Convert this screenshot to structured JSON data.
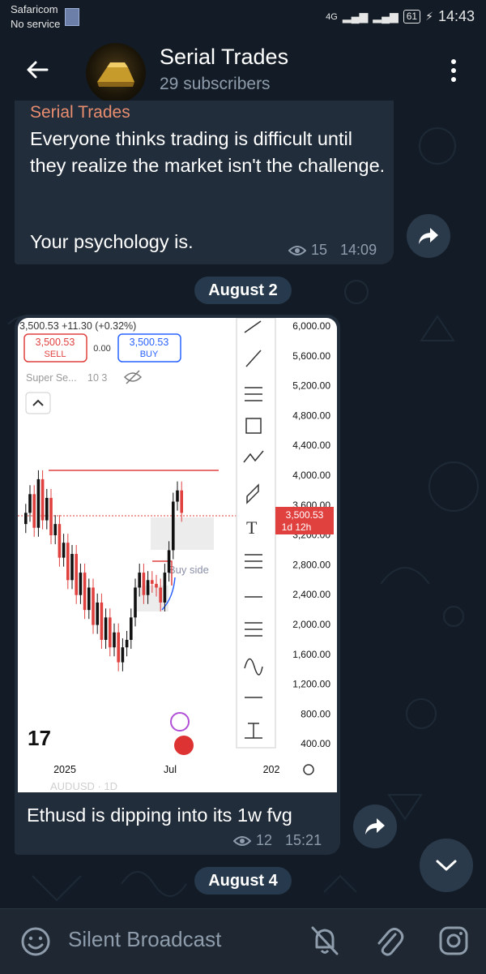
{
  "status_bar": {
    "carrier": "Safaricom",
    "service": "No service",
    "network": "4G",
    "battery": "61",
    "time": "14:43"
  },
  "header": {
    "channel_name": "Serial Trades",
    "subscribers": "29 subscribers",
    "icons": [
      "back-arrow-icon",
      "more-vertical-icon"
    ]
  },
  "messages": [
    {
      "sender": "Serial Trades",
      "text_line1": "Everyone thinks trading is difficult until they realize the market isn't the challenge.",
      "text_line2": "Your psychology is.",
      "views": "15",
      "time": "14:09"
    },
    {
      "date_separator": "August 2",
      "caption": "Ethusd is dipping into its 1w fvg",
      "views": "12",
      "time": "15:21"
    }
  ],
  "date_separator_bottom": "August 4",
  "chart_image": {
    "top_quote": "3,500.53 +11.30 (+0.32%)",
    "sell_price": "3,500.53",
    "sell_label": "SELL",
    "spread": "0.00",
    "buy_price": "3,500.53",
    "buy_label": "BUY",
    "indicator": "Super Se...",
    "indicator_params": "10 3",
    "current_price": "3,500.53",
    "countdown": "1d 12h",
    "zone_label": "Buy side",
    "bottom_watermark": "AUDUSD · 1D",
    "x_ticks": [
      "2025",
      "Jul",
      "202"
    ],
    "y_ticks": [
      "6,000.00",
      "5,600.00",
      "5,200.00",
      "4,800.00",
      "4,400.00",
      "4,000.00",
      "3,600.00",
      "3,200.00",
      "2,800.00",
      "2,400.00",
      "2,000.00",
      "1,600.00",
      "1,200.00",
      "800.00",
      "400.00"
    ],
    "candles_close": [
      3500,
      3750,
      3300,
      3950,
      3400,
      3700,
      3200,
      3350,
      2900,
      3100,
      2600,
      2950,
      2400,
      2700,
      2200,
      2500,
      2000,
      2300,
      1800,
      2100,
      1700,
      1900,
      1500,
      1700,
      1800,
      2100,
      2500,
      2700,
      2400,
      2600,
      2550,
      2500,
      2300,
      2700,
      3000,
      3650,
      3800,
      3500
    ],
    "colors": {
      "up": "#111111",
      "down": "#e0413f",
      "level": "#e0413f"
    }
  },
  "bottom_bar": {
    "placeholder": "Silent Broadcast",
    "icons": [
      "emoji-icon",
      "bell-off-icon",
      "paperclip-icon",
      "instagram-icon"
    ]
  },
  "colors": {
    "background": "#131c26",
    "bubble": "#212d3b",
    "sender": "#e98d6f",
    "meta": "#8e9cab",
    "pill": "#26394d"
  }
}
